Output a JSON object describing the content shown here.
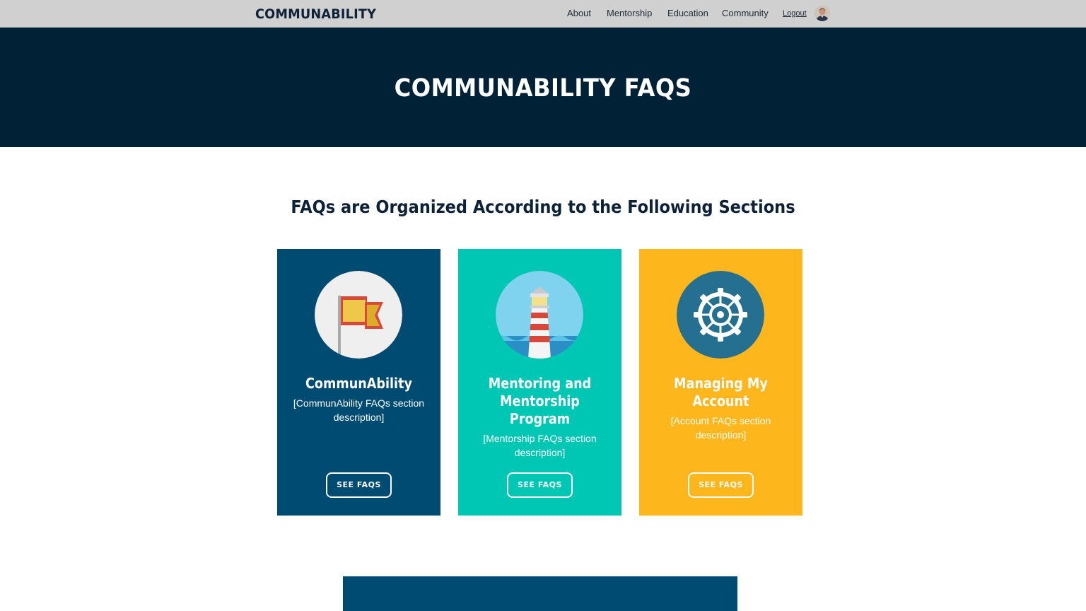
{
  "header": {
    "logo": "COMMUNABILITY",
    "nav": [
      "About",
      "Mentorship",
      "Education",
      "Community"
    ],
    "logout": "Logout"
  },
  "hero": {
    "title": "COMMUNABILITY FAQS"
  },
  "section": {
    "heading": "FAQs are Organized According to the Following Sections"
  },
  "cards": [
    {
      "title": "CommunAbility",
      "description": "[CommunAbility FAQs section description]",
      "button": "SEE FAQS",
      "icon": "flag-icon",
      "color": "#004b72"
    },
    {
      "title": "Mentoring and Mentorship Program",
      "description": "[Mentorship FAQs section description]",
      "button": "SEE FAQS",
      "icon": "lighthouse-icon",
      "color": "#00c6b4"
    },
    {
      "title": "Managing My Account",
      "description": "[Account FAQs section description]",
      "button": "SEE FAQS",
      "icon": "gear-icon",
      "color": "#fdb61c"
    }
  ],
  "colors": {
    "nav_bg": "#d0d0d0",
    "hero_bg": "#012236",
    "text_dark": "#0d2236"
  }
}
